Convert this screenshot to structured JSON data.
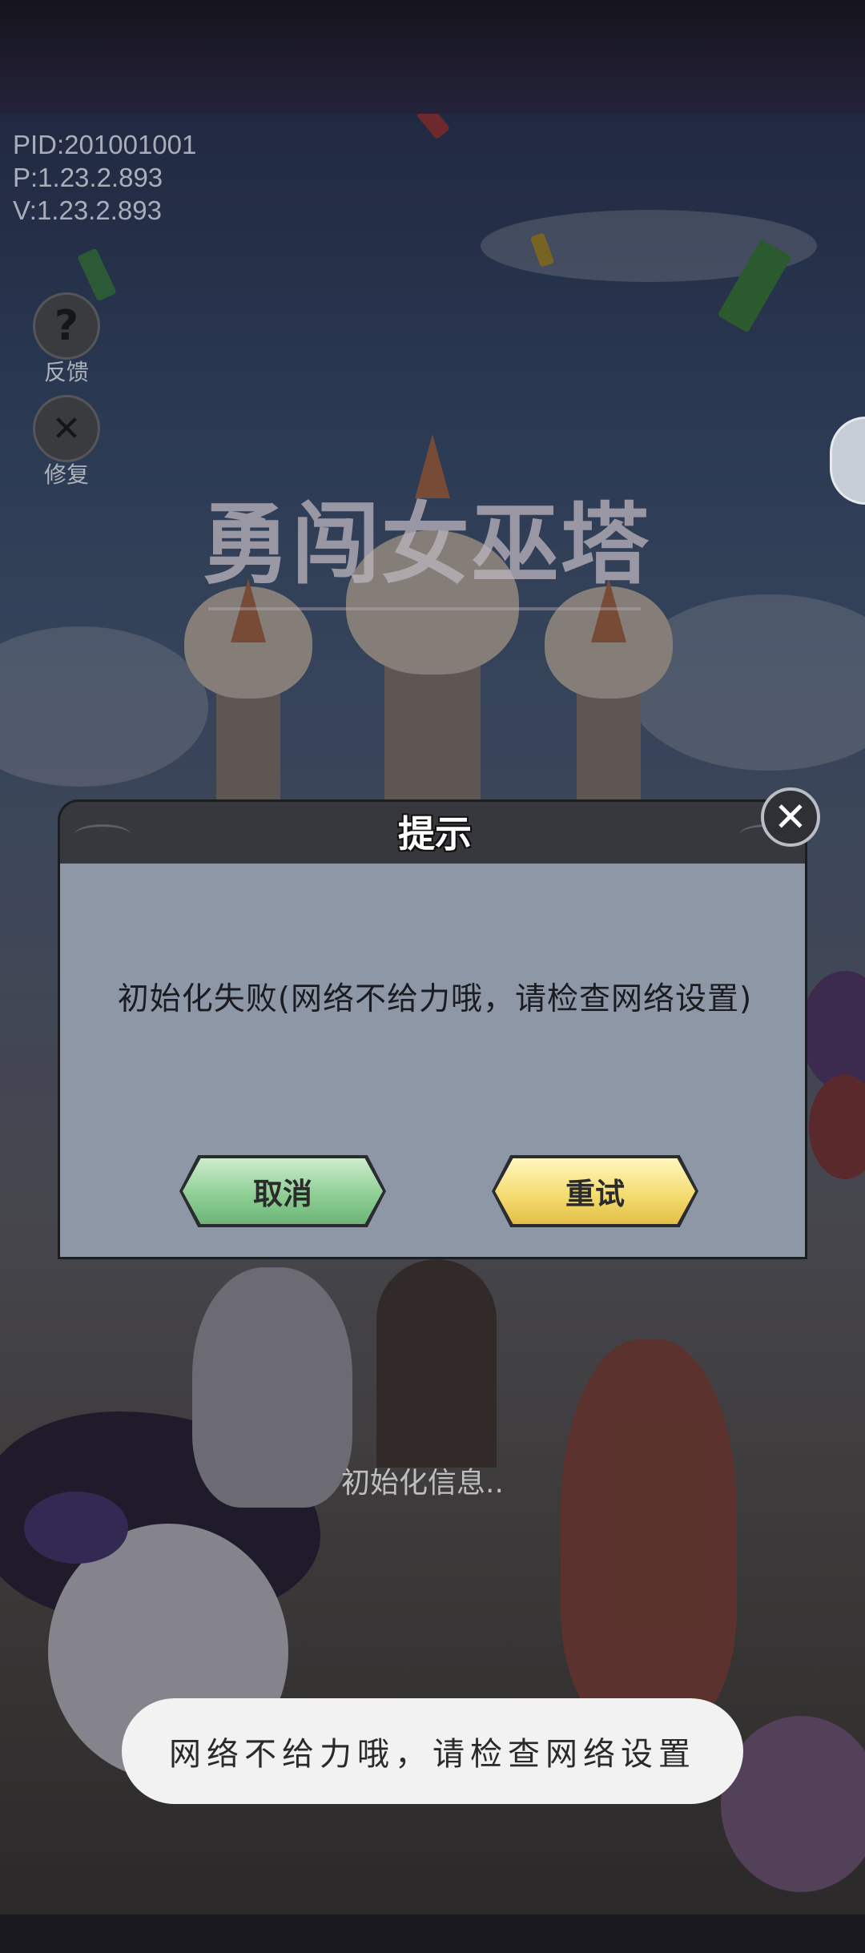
{
  "build_info": {
    "pid": "PID:201001001",
    "p": "P:1.23.2.893",
    "v": "V:1.23.2.893"
  },
  "side_buttons": {
    "feedback_label": "反馈",
    "repair_label": "修复"
  },
  "game_logo": "勇闯女巫塔",
  "dialog": {
    "title": "提示",
    "message": "初始化失败(网络不给力哦，请检查网络设置)",
    "cancel_label": "取消",
    "retry_label": "重试",
    "close_glyph": "✕"
  },
  "loading_text": "初始化信息..",
  "toast": "网络不给力哦，请检查网络设置",
  "colors": {
    "dialog_body": "#8e97a5",
    "dialog_header": "#36383e",
    "cancel_button": "#8fcf95",
    "retry_button": "#f5dc72"
  }
}
